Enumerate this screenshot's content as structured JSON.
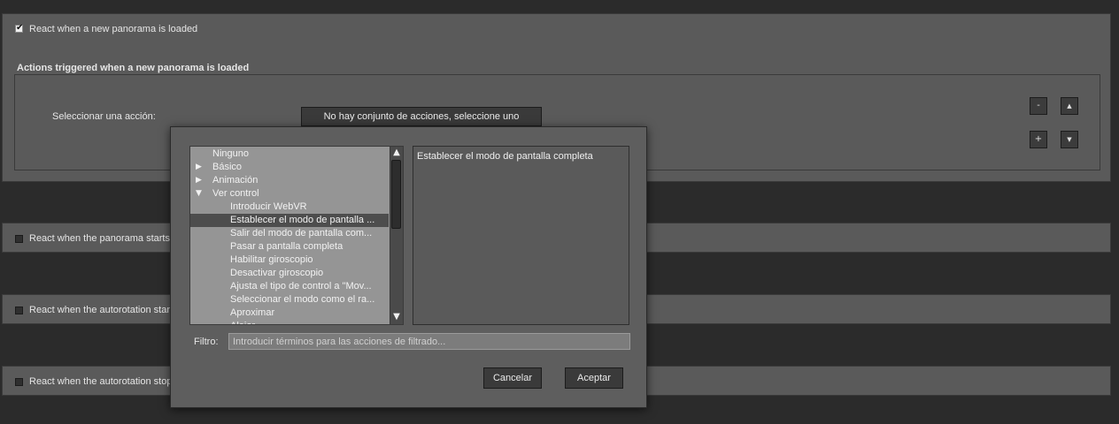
{
  "panel1": {
    "checkbox_label": "React when a new panorama is loaded",
    "checked": true,
    "actions_heading": "Actions triggered when a new panorama is loaded",
    "select_action_label": "Seleccionar una acción:",
    "action_button": "No hay conjunto de acciones, seleccione uno",
    "minus": "-",
    "plus": "+",
    "up": "▲",
    "down": "▼"
  },
  "panel2": {
    "checkbox_label": "React when the panorama starts",
    "checked": false
  },
  "panel3": {
    "checkbox_label": "React when the autorotation starts",
    "checked": false
  },
  "panel4": {
    "checkbox_label": "React when the autorotation stops",
    "checked": false
  },
  "dialog": {
    "tree": [
      {
        "label": "Ninguno",
        "level": 0,
        "expander": ""
      },
      {
        "label": "Básico",
        "level": 0,
        "expander": "▶"
      },
      {
        "label": "Animación",
        "level": 0,
        "expander": "▶"
      },
      {
        "label": "Ver control",
        "level": 0,
        "expander": "▼"
      },
      {
        "label": "Introducir WebVR",
        "level": 1,
        "expander": ""
      },
      {
        "label": "Establecer el modo de pantalla ...",
        "level": 1,
        "expander": "",
        "selected": true
      },
      {
        "label": "Salir del modo de pantalla com...",
        "level": 1,
        "expander": ""
      },
      {
        "label": "Pasar a pantalla completa",
        "level": 1,
        "expander": ""
      },
      {
        "label": "Habilitar giroscopio",
        "level": 1,
        "expander": ""
      },
      {
        "label": "Desactivar giroscopio",
        "level": 1,
        "expander": ""
      },
      {
        "label": "Ajusta el tipo de control a \"Mov...",
        "level": 1,
        "expander": ""
      },
      {
        "label": "Seleccionar el modo como el ra...",
        "level": 1,
        "expander": ""
      },
      {
        "label": "Aproximar",
        "level": 1,
        "expander": ""
      },
      {
        "label": "Alejar",
        "level": 1,
        "expander": ""
      }
    ],
    "scroll_up": "▲",
    "scroll_down": "▼",
    "description": "Establecer el modo de pantalla completa",
    "filter_label": "Filtro:",
    "filter_placeholder": "Introducir términos para las acciones de filtrado...",
    "cancel_button": "Cancelar",
    "accept_button": "Aceptar"
  }
}
